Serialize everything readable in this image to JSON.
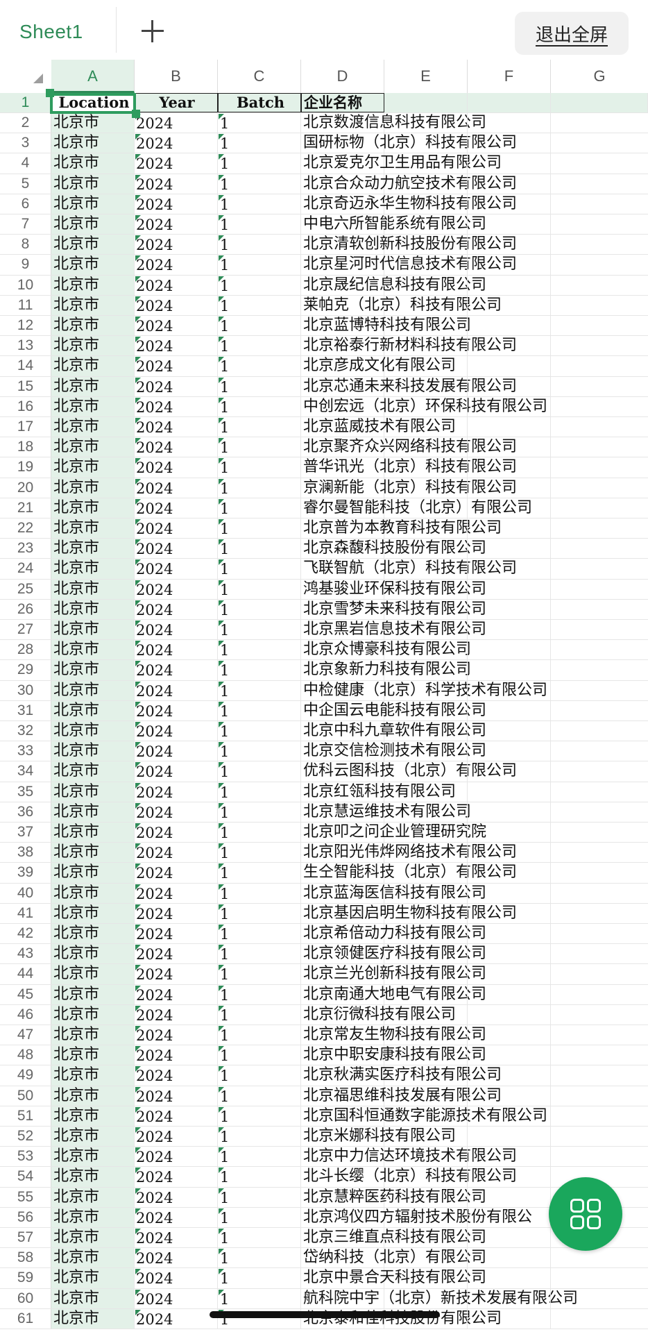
{
  "topbar": {
    "sheet_tab": "Sheet1",
    "exit_fullscreen": "退出全屏"
  },
  "columns": [
    "A",
    "B",
    "C",
    "D",
    "E",
    "F",
    "G"
  ],
  "header_row": {
    "row_number": "1",
    "location": "Location",
    "year": "Year",
    "batch": "Batch",
    "company": "企业名称"
  },
  "rows": [
    {
      "n": "2",
      "loc": "北京市",
      "year": "2024",
      "batch": "1",
      "name": "北京数渡信息科技有限公司"
    },
    {
      "n": "3",
      "loc": "北京市",
      "year": "2024",
      "batch": "1",
      "name": "国研标物（北京）科技有限公司"
    },
    {
      "n": "4",
      "loc": "北京市",
      "year": "2024",
      "batch": "1",
      "name": "北京爱克尔卫生用品有限公司"
    },
    {
      "n": "5",
      "loc": "北京市",
      "year": "2024",
      "batch": "1",
      "name": "北京合众动力航空技术有限公司"
    },
    {
      "n": "6",
      "loc": "北京市",
      "year": "2024",
      "batch": "1",
      "name": "北京奇迈永华生物科技有限公司"
    },
    {
      "n": "7",
      "loc": "北京市",
      "year": "2024",
      "batch": "1",
      "name": "中电六所智能系统有限公司"
    },
    {
      "n": "8",
      "loc": "北京市",
      "year": "2024",
      "batch": "1",
      "name": "北京清软创新科技股份有限公司"
    },
    {
      "n": "9",
      "loc": "北京市",
      "year": "2024",
      "batch": "1",
      "name": "北京星河时代信息技术有限公司"
    },
    {
      "n": "10",
      "loc": "北京市",
      "year": "2024",
      "batch": "1",
      "name": "北京晟纪信息科技有限公司"
    },
    {
      "n": "11",
      "loc": "北京市",
      "year": "2024",
      "batch": "1",
      "name": "莱帕克（北京）科技有限公司"
    },
    {
      "n": "12",
      "loc": "北京市",
      "year": "2024",
      "batch": "1",
      "name": "北京蓝博特科技有限公司"
    },
    {
      "n": "13",
      "loc": "北京市",
      "year": "2024",
      "batch": "1",
      "name": "北京裕泰行新材料科技有限公司"
    },
    {
      "n": "14",
      "loc": "北京市",
      "year": "2024",
      "batch": "1",
      "name": "北京彦成文化有限公司"
    },
    {
      "n": "15",
      "loc": "北京市",
      "year": "2024",
      "batch": "1",
      "name": "北京芯通未来科技发展有限公司"
    },
    {
      "n": "16",
      "loc": "北京市",
      "year": "2024",
      "batch": "1",
      "name": "中创宏远（北京）环保科技有限公司"
    },
    {
      "n": "17",
      "loc": "北京市",
      "year": "2024",
      "batch": "1",
      "name": "北京蓝威技术有限公司"
    },
    {
      "n": "18",
      "loc": "北京市",
      "year": "2024",
      "batch": "1",
      "name": "北京聚齐众兴网络科技有限公司"
    },
    {
      "n": "19",
      "loc": "北京市",
      "year": "2024",
      "batch": "1",
      "name": "普华讯光（北京）科技有限公司"
    },
    {
      "n": "20",
      "loc": "北京市",
      "year": "2024",
      "batch": "1",
      "name": "京澜新能（北京）科技有限公司"
    },
    {
      "n": "21",
      "loc": "北京市",
      "year": "2024",
      "batch": "1",
      "name": "睿尔曼智能科技（北京）有限公司"
    },
    {
      "n": "22",
      "loc": "北京市",
      "year": "2024",
      "batch": "1",
      "name": "北京普为本教育科技有限公司"
    },
    {
      "n": "23",
      "loc": "北京市",
      "year": "2024",
      "batch": "1",
      "name": "北京森馥科技股份有限公司"
    },
    {
      "n": "24",
      "loc": "北京市",
      "year": "2024",
      "batch": "1",
      "name": "飞联智航（北京）科技有限公司"
    },
    {
      "n": "25",
      "loc": "北京市",
      "year": "2024",
      "batch": "1",
      "name": "鸿基骏业环保科技有限公司"
    },
    {
      "n": "26",
      "loc": "北京市",
      "year": "2024",
      "batch": "1",
      "name": "北京雪梦未来科技有限公司"
    },
    {
      "n": "27",
      "loc": "北京市",
      "year": "2024",
      "batch": "1",
      "name": "北京黑岩信息技术有限公司"
    },
    {
      "n": "28",
      "loc": "北京市",
      "year": "2024",
      "batch": "1",
      "name": "北京众博豪科技有限公司"
    },
    {
      "n": "29",
      "loc": "北京市",
      "year": "2024",
      "batch": "1",
      "name": "北京象新力科技有限公司"
    },
    {
      "n": "30",
      "loc": "北京市",
      "year": "2024",
      "batch": "1",
      "name": "中检健康（北京）科学技术有限公司"
    },
    {
      "n": "31",
      "loc": "北京市",
      "year": "2024",
      "batch": "1",
      "name": "中企国云电能科技有限公司"
    },
    {
      "n": "32",
      "loc": "北京市",
      "year": "2024",
      "batch": "1",
      "name": "北京中科九章软件有限公司"
    },
    {
      "n": "33",
      "loc": "北京市",
      "year": "2024",
      "batch": "1",
      "name": "北京交信检测技术有限公司"
    },
    {
      "n": "34",
      "loc": "北京市",
      "year": "2024",
      "batch": "1",
      "name": "优科云图科技（北京）有限公司"
    },
    {
      "n": "35",
      "loc": "北京市",
      "year": "2024",
      "batch": "1",
      "name": "北京红瓴科技有限公司"
    },
    {
      "n": "36",
      "loc": "北京市",
      "year": "2024",
      "batch": "1",
      "name": "北京慧运维技术有限公司"
    },
    {
      "n": "37",
      "loc": "北京市",
      "year": "2024",
      "batch": "1",
      "name": "北京叩之问企业管理研究院"
    },
    {
      "n": "38",
      "loc": "北京市",
      "year": "2024",
      "batch": "1",
      "name": "北京阳光伟烨网络技术有限公司"
    },
    {
      "n": "39",
      "loc": "北京市",
      "year": "2024",
      "batch": "1",
      "name": "生仝智能科技（北京）有限公司"
    },
    {
      "n": "40",
      "loc": "北京市",
      "year": "2024",
      "batch": "1",
      "name": "北京蓝海医信科技有限公司"
    },
    {
      "n": "41",
      "loc": "北京市",
      "year": "2024",
      "batch": "1",
      "name": "北京基因启明生物科技有限公司"
    },
    {
      "n": "42",
      "loc": "北京市",
      "year": "2024",
      "batch": "1",
      "name": "北京希倍动力科技有限公司"
    },
    {
      "n": "43",
      "loc": "北京市",
      "year": "2024",
      "batch": "1",
      "name": "北京领健医疗科技有限公司"
    },
    {
      "n": "44",
      "loc": "北京市",
      "year": "2024",
      "batch": "1",
      "name": "北京兰光创新科技有限公司"
    },
    {
      "n": "45",
      "loc": "北京市",
      "year": "2024",
      "batch": "1",
      "name": "北京南通大地电气有限公司"
    },
    {
      "n": "46",
      "loc": "北京市",
      "year": "2024",
      "batch": "1",
      "name": "北京衍微科技有限公司"
    },
    {
      "n": "47",
      "loc": "北京市",
      "year": "2024",
      "batch": "1",
      "name": "北京常友生物科技有限公司"
    },
    {
      "n": "48",
      "loc": "北京市",
      "year": "2024",
      "batch": "1",
      "name": "北京中职安康科技有限公司"
    },
    {
      "n": "49",
      "loc": "北京市",
      "year": "2024",
      "batch": "1",
      "name": "北京秋满实医疗科技有限公司"
    },
    {
      "n": "50",
      "loc": "北京市",
      "year": "2024",
      "batch": "1",
      "name": "北京福思维科技发展有限公司"
    },
    {
      "n": "51",
      "loc": "北京市",
      "year": "2024",
      "batch": "1",
      "name": "北京国科恒通数字能源技术有限公司"
    },
    {
      "n": "52",
      "loc": "北京市",
      "year": "2024",
      "batch": "1",
      "name": "北京米娜科技有限公司"
    },
    {
      "n": "53",
      "loc": "北京市",
      "year": "2024",
      "batch": "1",
      "name": "北京中力信达环境技术有限公司"
    },
    {
      "n": "54",
      "loc": "北京市",
      "year": "2024",
      "batch": "1",
      "name": "北斗长缨（北京）科技有限公司"
    },
    {
      "n": "55",
      "loc": "北京市",
      "year": "2024",
      "batch": "1",
      "name": "北京慧粹医药科技有限公司"
    },
    {
      "n": "56",
      "loc": "北京市",
      "year": "2024",
      "batch": "1",
      "name": "北京鸿仪四方辐射技术股份有限公"
    },
    {
      "n": "57",
      "loc": "北京市",
      "year": "2024",
      "batch": "1",
      "name": "北京三维直点科技有限公司"
    },
    {
      "n": "58",
      "loc": "北京市",
      "year": "2024",
      "batch": "1",
      "name": "岱纳科技（北京）有限公司"
    },
    {
      "n": "59",
      "loc": "北京市",
      "year": "2024",
      "batch": "1",
      "name": "北京中景合天科技有限公司"
    },
    {
      "n": "60",
      "loc": "北京市",
      "year": "2024",
      "batch": "1",
      "name": "航科院中宇（北京）新技术发展有限公司"
    },
    {
      "n": "61",
      "loc": "北京市",
      "year": "2024",
      "batch": "1",
      "name": "北京泰和佳科技股份有限公司"
    }
  ],
  "fab_icon": "apps-grid-icon",
  "colors": {
    "accent": "#2e8b57",
    "selection_fill": "#e3f1e8",
    "fab": "#1aa75c"
  }
}
